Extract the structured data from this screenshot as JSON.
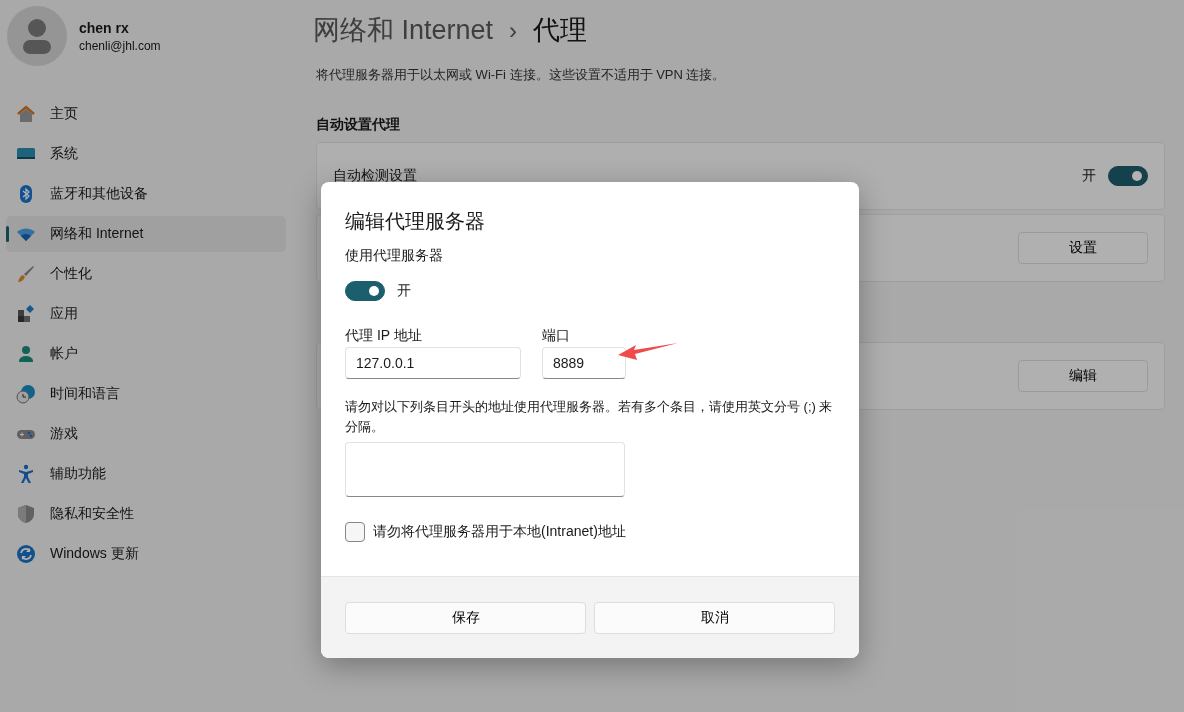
{
  "user": {
    "name": "chen rx",
    "email": "chenli@jhl.com"
  },
  "nav": [
    {
      "label": "主页",
      "selected": false
    },
    {
      "label": "系统",
      "selected": false
    },
    {
      "label": "蓝牙和其他设备",
      "selected": false
    },
    {
      "label": "网络和 Internet",
      "selected": true
    },
    {
      "label": "个性化",
      "selected": false
    },
    {
      "label": "应用",
      "selected": false
    },
    {
      "label": "帐户",
      "selected": false
    },
    {
      "label": "时间和语言",
      "selected": false
    },
    {
      "label": "游戏",
      "selected": false
    },
    {
      "label": "辅助功能",
      "selected": false
    },
    {
      "label": "隐私和安全性",
      "selected": false
    },
    {
      "label": "Windows 更新",
      "selected": false
    }
  ],
  "header": {
    "parent": "网络和 Internet",
    "separator": "›",
    "current": "代理",
    "description": "将代理服务器用于以太网或 Wi-Fi 连接。这些设置不适用于 VPN 连接。"
  },
  "auto_section": {
    "heading": "自动设置代理",
    "rows": [
      {
        "kind": "toggle",
        "label": "自动检测设置",
        "state_text": "开",
        "on": true
      },
      {
        "kind": "button",
        "button": "设置"
      }
    ]
  },
  "manual_section": {
    "rows": [
      {
        "kind": "button",
        "button": "编辑"
      }
    ]
  },
  "dialog": {
    "title": "编辑代理服务器",
    "use_proxy_label": "使用代理服务器",
    "proxy_on": true,
    "on_text": "开",
    "ip_label": "代理 IP 地址",
    "ip_value": "127.0.0.1",
    "port_label": "端口",
    "port_value": "8889",
    "exceptions_label": "请勿对以下列条目开头的地址使用代理服务器。若有多个条目，请使用英文分号 (;) 来分隔。",
    "bypass_local": {
      "label": "请勿将代理服务器用于本地(Intranet)地址",
      "checked": false
    },
    "buttons": [
      "保存",
      "取消"
    ]
  }
}
